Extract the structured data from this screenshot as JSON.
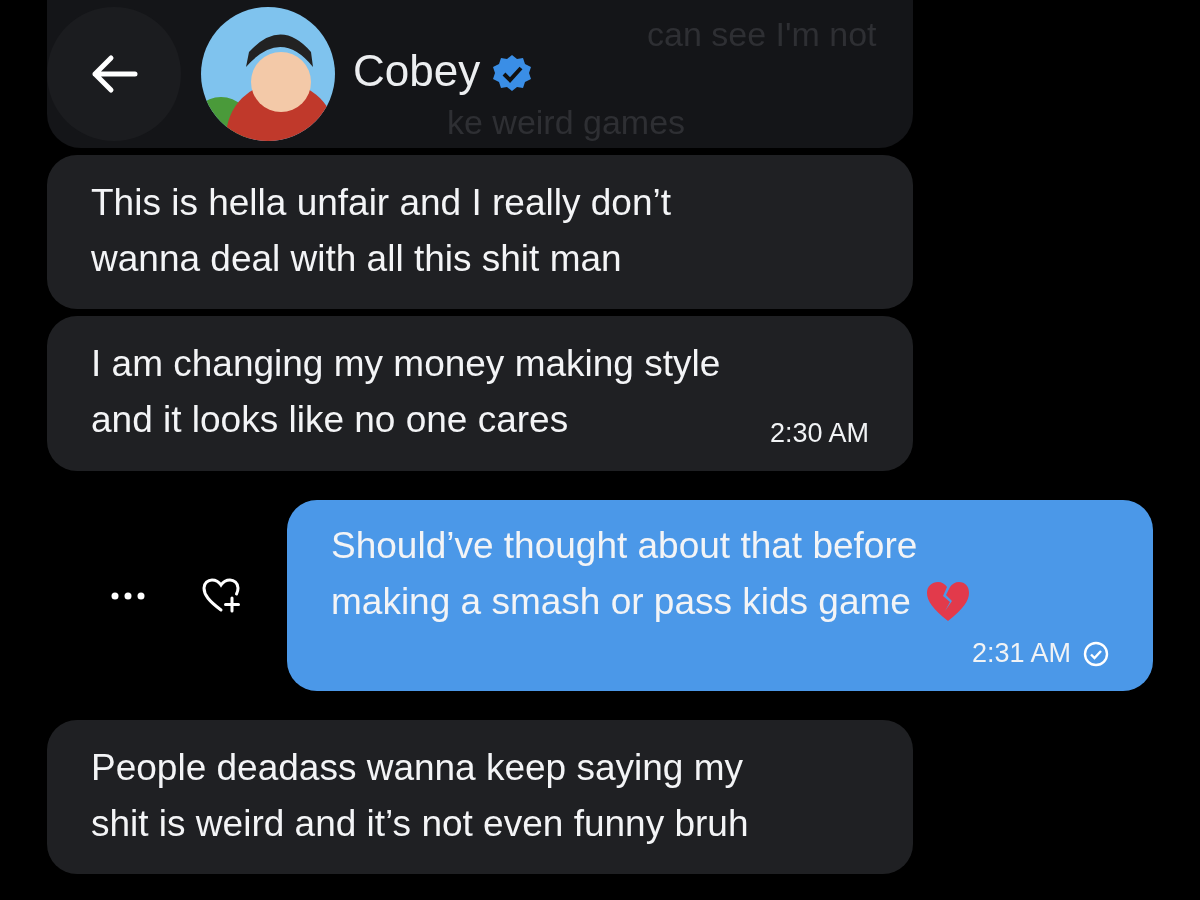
{
  "header": {
    "name": "Cobey",
    "verified": true,
    "hidden_fragments": [
      "can see I'm not",
      "ke weird games"
    ]
  },
  "messages": [
    {
      "kind": "received",
      "lines": [
        "This is hella unfair and I really don’t",
        "wanna deal with all this shit man"
      ]
    },
    {
      "kind": "received",
      "lines": [
        "I am changing my money making style",
        "and it looks like no one cares"
      ],
      "time": "2:30 AM"
    },
    {
      "kind": "sent",
      "lines": [
        "Should’ve thought about that before",
        "making a smash or pass kids game"
      ],
      "broken_heart": true,
      "time": "2:31 AM",
      "read": true
    },
    {
      "kind": "received",
      "lines": [
        "People deadass wanna keep saying my",
        "shit is weird and it’s not even funny bruh"
      ]
    }
  ]
}
